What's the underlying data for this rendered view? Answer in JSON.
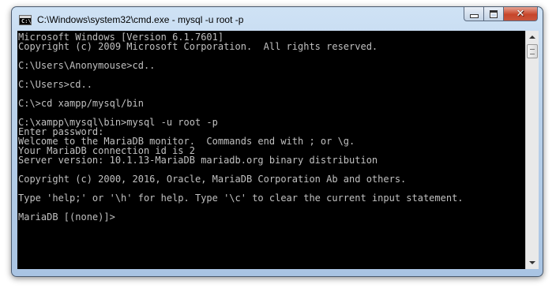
{
  "window": {
    "title": "C:\\Windows\\system32\\cmd.exe - mysql  -u root -p",
    "icon": "cmd-console-icon",
    "buttons": {
      "minimize": "minimize-icon",
      "maximize": "maximize-icon",
      "close_glyph": "✕"
    }
  },
  "console": {
    "text_color": "#c0c0c0",
    "background": "#000000",
    "lines": [
      "Microsoft Windows [Version 6.1.7601]",
      "Copyright (c) 2009 Microsoft Corporation.  All rights reserved.",
      "",
      "C:\\Users\\Anonymouse>cd..",
      "",
      "C:\\Users>cd..",
      "",
      "C:\\>cd xampp/mysql/bin",
      "",
      "C:\\xampp\\mysql\\bin>mysql -u root -p",
      "Enter password:",
      "Welcome to the MariaDB monitor.  Commands end with ; or \\g.",
      "Your MariaDB connection id is 2",
      "Server version: 10.1.13-MariaDB mariadb.org binary distribution",
      "",
      "Copyright (c) 2000, 2016, Oracle, MariaDB Corporation Ab and others.",
      "",
      "Type 'help;' or '\\h' for help. Type '\\c' to clear the current input statement.",
      "",
      "MariaDB [(none)]>"
    ]
  }
}
